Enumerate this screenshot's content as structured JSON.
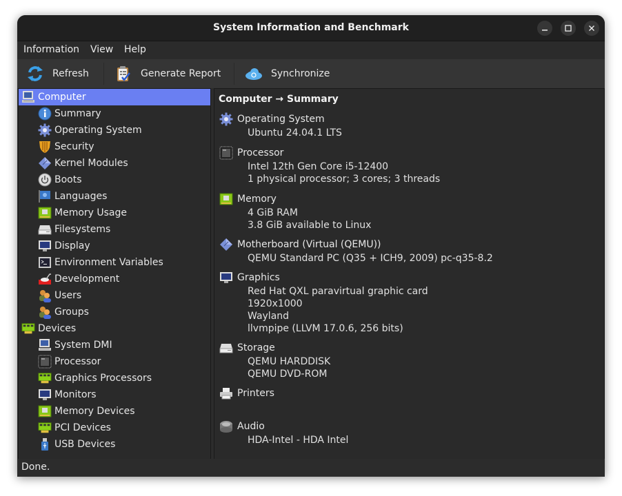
{
  "window": {
    "title": "System Information and Benchmark",
    "controls": {
      "minimize": "–",
      "maximize": "□",
      "close": "✕"
    }
  },
  "menubar": {
    "items": [
      {
        "label": "Information"
      },
      {
        "label": "View"
      },
      {
        "label": "Help"
      }
    ]
  },
  "toolbar": {
    "refresh_label": "Refresh",
    "report_label": "Generate Report",
    "sync_label": "Synchronize"
  },
  "sidebar": {
    "items": [
      {
        "label": "Computer",
        "icon": "computer-icon",
        "level": 0,
        "selected": true
      },
      {
        "label": "Summary",
        "icon": "info-icon",
        "level": 1
      },
      {
        "label": "Operating System",
        "icon": "gear-icon",
        "level": 1
      },
      {
        "label": "Security",
        "icon": "shield-icon",
        "level": 1
      },
      {
        "label": "Kernel Modules",
        "icon": "module-icon",
        "level": 1
      },
      {
        "label": "Boots",
        "icon": "power-icon",
        "level": 1
      },
      {
        "label": "Languages",
        "icon": "flag-icon",
        "level": 1
      },
      {
        "label": "Memory Usage",
        "icon": "memory-icon",
        "level": 1
      },
      {
        "label": "Filesystems",
        "icon": "drive-icon",
        "level": 1
      },
      {
        "label": "Display",
        "icon": "monitor-icon",
        "level": 1
      },
      {
        "label": "Environment Variables",
        "icon": "terminal-icon",
        "level": 1
      },
      {
        "label": "Development",
        "icon": "development-icon",
        "level": 1
      },
      {
        "label": "Users",
        "icon": "users-icon",
        "level": 1
      },
      {
        "label": "Groups",
        "icon": "groups-icon",
        "level": 1
      },
      {
        "label": "Devices",
        "icon": "pci-card-icon",
        "level": 0
      },
      {
        "label": "System DMI",
        "icon": "computer-icon",
        "level": 1
      },
      {
        "label": "Processor",
        "icon": "cpu-icon",
        "level": 1
      },
      {
        "label": "Graphics Processors",
        "icon": "pci-card-icon",
        "level": 1
      },
      {
        "label": "Monitors",
        "icon": "monitor-icon",
        "level": 1
      },
      {
        "label": "Memory Devices",
        "icon": "memory-icon",
        "level": 1
      },
      {
        "label": "PCI Devices",
        "icon": "pci-card-icon",
        "level": 1
      },
      {
        "label": "USB Devices",
        "icon": "usb-icon",
        "level": 1
      }
    ]
  },
  "content": {
    "breadcrumb": "Computer → Summary",
    "sections": [
      {
        "title": "Operating System",
        "icon": "gear-icon",
        "lines": [
          "Ubuntu 24.04.1 LTS"
        ]
      },
      {
        "title": "Processor",
        "icon": "cpu-icon",
        "lines": [
          "Intel 12th Gen Core i5-12400",
          "1 physical processor; 3 cores; 3 threads"
        ]
      },
      {
        "title": "Memory",
        "icon": "memory-icon",
        "lines": [
          "4 GiB RAM",
          "3.8 GiB available to Linux"
        ]
      },
      {
        "title": "Motherboard (Virtual (QEMU))",
        "icon": "module-icon",
        "lines": [
          "QEMU Standard PC (Q35 + ICH9, 2009) pc-q35-8.2"
        ]
      },
      {
        "title": "Graphics",
        "icon": "monitor-icon",
        "lines": [
          "Red Hat QXL paravirtual graphic card",
          "1920x1000",
          "Wayland",
          "llvmpipe (LLVM 17.0.6, 256 bits)"
        ]
      },
      {
        "title": "Storage",
        "icon": "drive-icon",
        "lines": [
          "QEMU HARDDISK",
          "QEMU DVD-ROM"
        ]
      },
      {
        "title": "Printers",
        "icon": "printer-icon",
        "lines": []
      },
      {
        "title": "Audio",
        "icon": "speaker-icon",
        "lines": [
          "HDA-Intel - HDA Intel"
        ]
      }
    ]
  },
  "status": {
    "text": "Done."
  },
  "colors": {
    "selection": "#6a7ff2",
    "background": "#2a2a2a",
    "titlebar": "#202020"
  }
}
